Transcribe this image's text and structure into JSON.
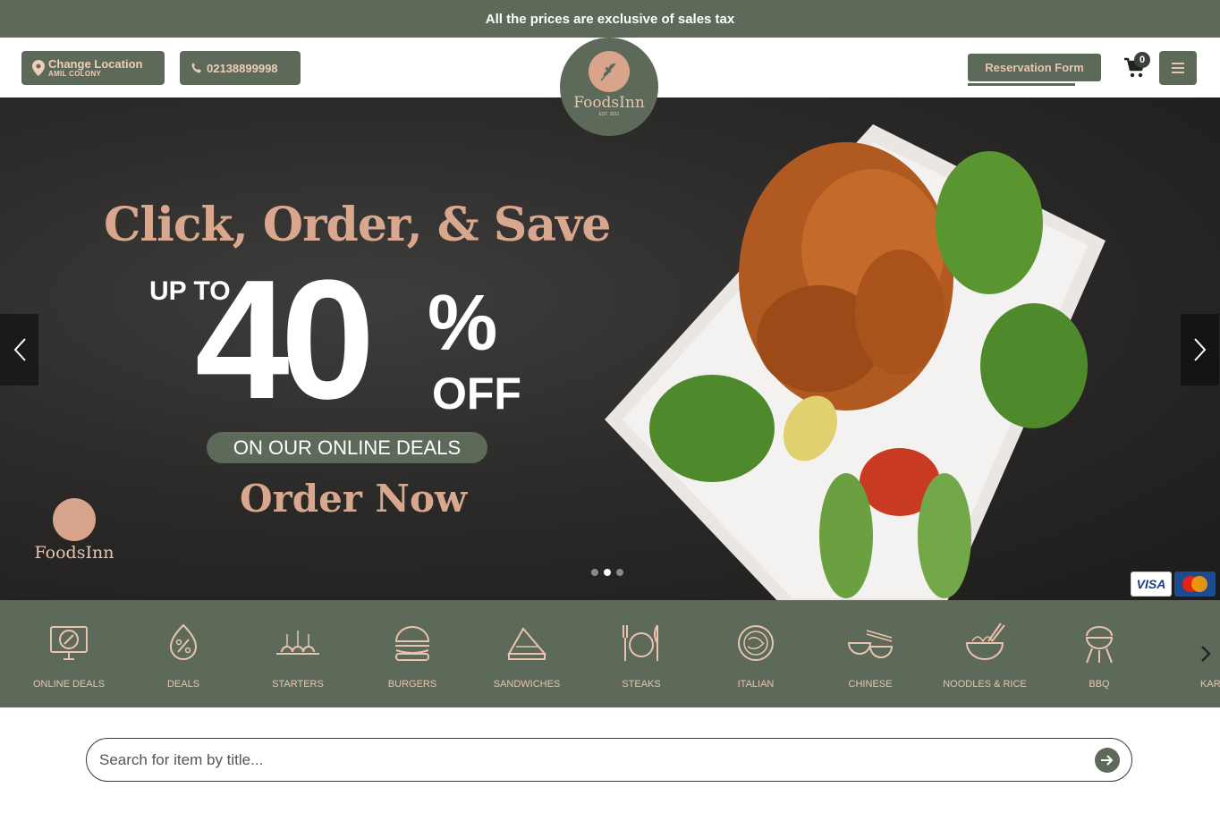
{
  "topbar": {
    "notice": "All the prices are exclusive of sales tax"
  },
  "header": {
    "location_label": "Change Location",
    "location_value": "AMIL COLONY",
    "phone": "02138899998",
    "logo_name": "FoodsInn",
    "logo_est": "EST. 2011",
    "reservation_label": "Reservation Form",
    "cart_count": "0"
  },
  "hero": {
    "title": "Click, Order, & Save",
    "up_to": "UP TO",
    "discount_number": "40",
    "percent": "%",
    "off": "OFF",
    "pill": "ON OUR ONLINE DEALS",
    "cta": "Order Now",
    "logo_name": "FoodsInn",
    "slides_total": 3,
    "active_slide": 2,
    "visa": "VISA"
  },
  "categories": [
    {
      "label": "ONLINE DEALS",
      "icon": "online-deals-icon"
    },
    {
      "label": "DEALS",
      "icon": "deals-icon"
    },
    {
      "label": "STARTERS",
      "icon": "starters-icon"
    },
    {
      "label": "BURGERS",
      "icon": "burger-icon"
    },
    {
      "label": "SANDWICHES",
      "icon": "sandwich-icon"
    },
    {
      "label": "STEAKS",
      "icon": "steak-icon"
    },
    {
      "label": "ITALIAN",
      "icon": "italian-icon"
    },
    {
      "label": "CHINESE",
      "icon": "chinese-icon"
    },
    {
      "label": "NOODLES & RICE",
      "icon": "noodles-icon"
    },
    {
      "label": "BBQ",
      "icon": "bbq-icon"
    },
    {
      "label": "KARA",
      "icon": "karahi-icon"
    }
  ],
  "search": {
    "placeholder": "Search for item by title..."
  },
  "colors": {
    "brand": "#5d6a5a",
    "accent": "#e8c4b0",
    "hero_text": "#d9a78e"
  }
}
